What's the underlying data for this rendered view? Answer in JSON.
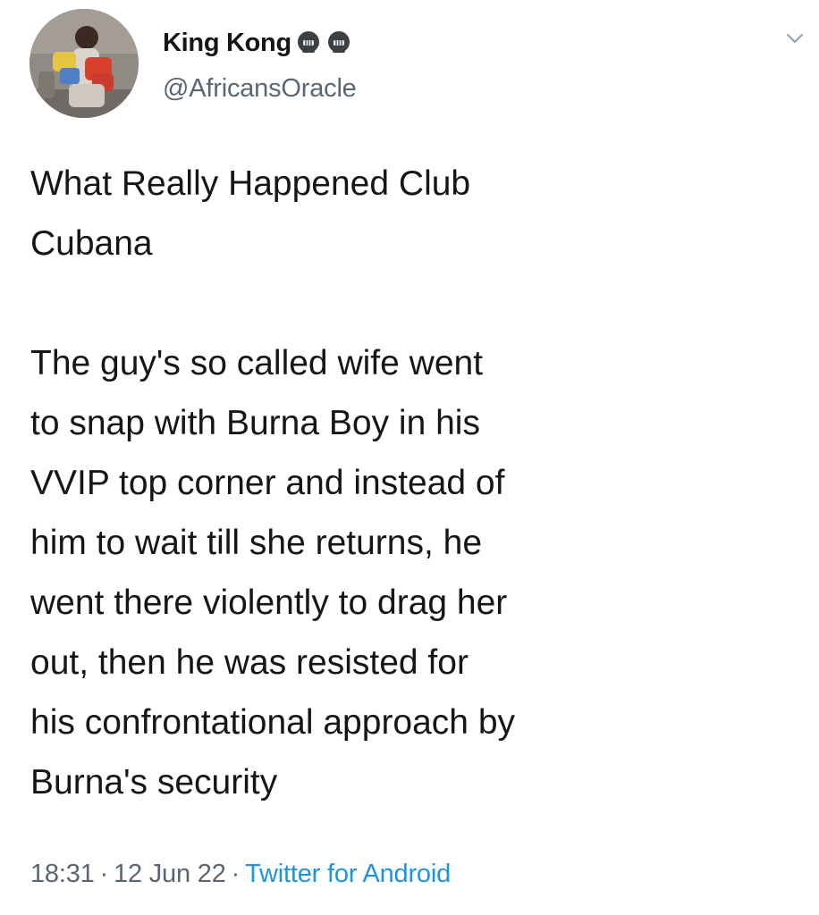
{
  "author": {
    "display_name": "King Kong",
    "handle": "@AfricansOracle",
    "badge_emojis": [
      "skull-icon",
      "skull-icon"
    ]
  },
  "tweet": {
    "paragraph_1": "What Really Happened Club\nCubana",
    "paragraph_2": "The guy's so called wife went\nto snap with Burna Boy in his\nVVIP top corner and instead of\nhim to wait till she returns, he\nwent there violently to drag her\nout, then he was resisted for\nhis confrontational approach by\nBurna's security"
  },
  "meta": {
    "time": "18:31",
    "separator": "·",
    "date": "12 Jun 22",
    "source": "Twitter for Android"
  },
  "colors": {
    "text": "#14171a",
    "secondary": "#5b6670",
    "link": "#1b95e0"
  }
}
